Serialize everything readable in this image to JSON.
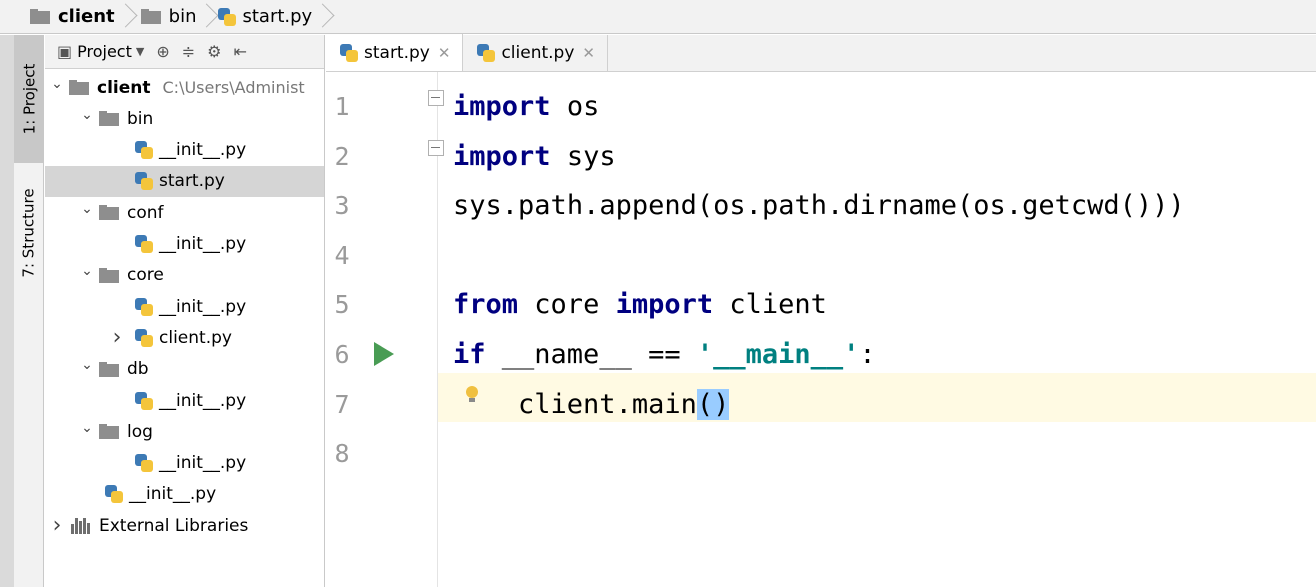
{
  "breadcrumb": {
    "items": [
      {
        "label": "client",
        "icon": "folder-icon"
      },
      {
        "label": "bin",
        "icon": "folder-icon"
      },
      {
        "label": "start.py",
        "icon": "python-file-icon"
      }
    ]
  },
  "side_tabs": {
    "project": "1: Project",
    "structure": "7: Structure"
  },
  "project_panel": {
    "view_label": "Project",
    "tree": [
      {
        "label": "client",
        "hint": "C:\\Users\\Administ",
        "type": "folder",
        "expanded": true,
        "depth": 0
      },
      {
        "label": "bin",
        "type": "folder",
        "expanded": true,
        "depth": 1
      },
      {
        "label": "__init__.py",
        "type": "python",
        "depth": 2
      },
      {
        "label": "start.py",
        "type": "python",
        "depth": 2,
        "selected": true
      },
      {
        "label": "conf",
        "type": "folder",
        "expanded": true,
        "depth": 1
      },
      {
        "label": "__init__.py",
        "type": "python",
        "depth": 2
      },
      {
        "label": "core",
        "type": "folder",
        "expanded": true,
        "depth": 1
      },
      {
        "label": "__init__.py",
        "type": "python",
        "depth": 2
      },
      {
        "label": "client.py",
        "type": "python",
        "depth": 2,
        "collapsed": true
      },
      {
        "label": "db",
        "type": "folder",
        "expanded": true,
        "depth": 1
      },
      {
        "label": "__init__.py",
        "type": "python",
        "depth": 2
      },
      {
        "label": "log",
        "type": "folder",
        "expanded": true,
        "depth": 1
      },
      {
        "label": "__init__.py",
        "type": "python",
        "depth": 2
      },
      {
        "label": "__init__.py",
        "type": "python",
        "depth": 1
      },
      {
        "label": "External Libraries",
        "type": "library",
        "collapsed": true,
        "depth": 0
      }
    ]
  },
  "editor": {
    "tabs": [
      {
        "label": "start.py",
        "active": true
      },
      {
        "label": "client.py",
        "active": false
      }
    ],
    "lines": [
      {
        "n": "1",
        "code": "import os"
      },
      {
        "n": "2",
        "code": "import sys"
      },
      {
        "n": "3",
        "code": "sys.path.append(os.path.dirname(os.getcwd()))"
      },
      {
        "n": "4",
        "code": ""
      },
      {
        "n": "5",
        "code": "from core import client"
      },
      {
        "n": "6",
        "code": "if __name__ == '__main__':"
      },
      {
        "n": "7",
        "code": "    client.main()"
      },
      {
        "n": "8",
        "code": ""
      }
    ]
  },
  "colors": {
    "keyword": "#000080",
    "string": "#008080",
    "current_line": "#fffae3",
    "brace_match": "#99ccff"
  }
}
